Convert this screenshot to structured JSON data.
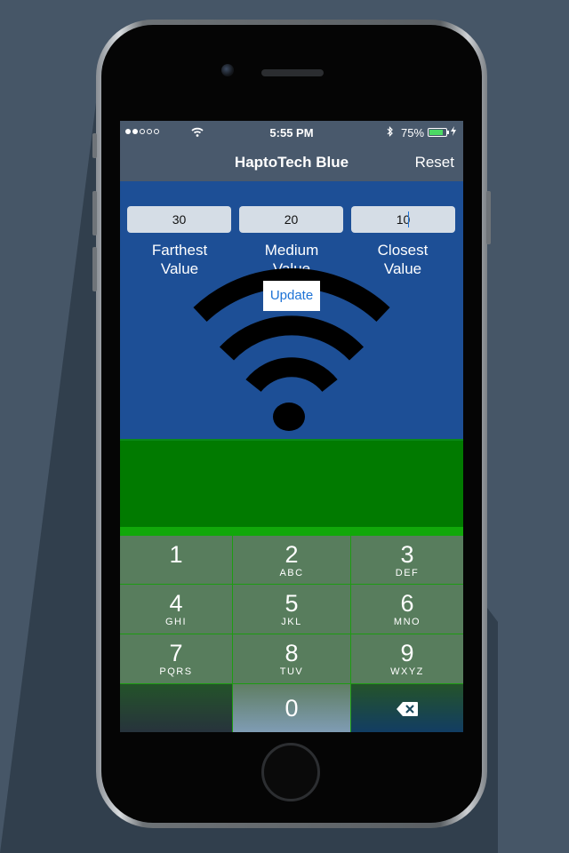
{
  "status_bar": {
    "time": "5:55 PM",
    "battery": "75%",
    "bluetooth_icon": "bluetooth-icon"
  },
  "nav": {
    "title": "HaptoTech Blue",
    "reset_label": "Reset"
  },
  "fields": [
    {
      "value": "30",
      "caption_line1": "Farthest",
      "caption_line2": "Value"
    },
    {
      "value": "20",
      "caption_line1": "Medium",
      "caption_line2": "Value"
    },
    {
      "value": "10",
      "caption_line1": "Closest",
      "caption_line2": "Value"
    }
  ],
  "update_label": "Update",
  "keypad": {
    "keys": [
      {
        "num": "1",
        "letters": ""
      },
      {
        "num": "2",
        "letters": "ABC"
      },
      {
        "num": "3",
        "letters": "DEF"
      },
      {
        "num": "4",
        "letters": "GHI"
      },
      {
        "num": "5",
        "letters": "JKL"
      },
      {
        "num": "6",
        "letters": "MNO"
      },
      {
        "num": "7",
        "letters": "PQRS"
      },
      {
        "num": "8",
        "letters": "TUV"
      },
      {
        "num": "9",
        "letters": "WXYZ"
      },
      {
        "num": "0",
        "letters": ""
      }
    ],
    "delete_icon": "backspace-icon"
  },
  "colors": {
    "content_bg": "#1d4f96",
    "navbar_bg": "#49596c",
    "green_band": "#017a00",
    "update_text": "#1e73d6"
  }
}
